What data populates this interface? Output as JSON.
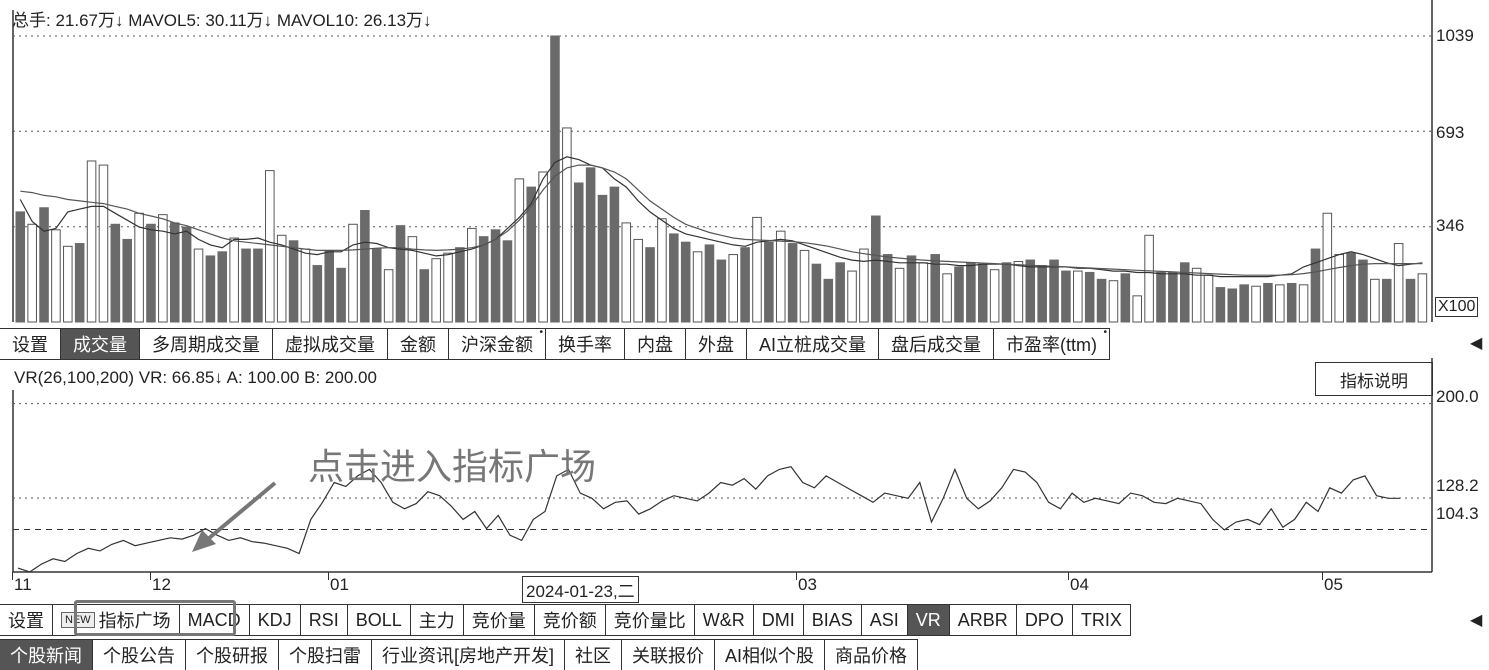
{
  "volume_panel": {
    "header": "总手: 21.67万↓ MAVOL5: 30.11万↓ MAVOL10: 26.13万↓",
    "y_ticks": [
      "1039",
      "693",
      "346"
    ],
    "unit": "X100"
  },
  "volume_tabs": [
    "设置",
    "成交量",
    "多周期成交量",
    "虚拟成交量",
    "金额",
    "沪深金额",
    "换手率",
    "内盘",
    "外盘",
    "AI立桩成交量",
    "盘后成交量",
    "市盈率(ttm)"
  ],
  "volume_tabs_marked": [
    "沪深金额",
    "市盈率(ttm)"
  ],
  "volume_tab_active": "成交量",
  "vr_panel": {
    "header": "VR(26,100,200) VR: 66.85↓ A: 100.00 B: 200.00",
    "help_button": "指标说明",
    "y_ticks": [
      "200.0",
      "128.2",
      "104.3"
    ],
    "annotation": "点击进入指标广场"
  },
  "x_axis": {
    "labels": [
      "11",
      "12",
      "01",
      "03",
      "04",
      "05"
    ],
    "cursor_date": "2024-01-23,二"
  },
  "indicator_tabs": [
    "设置",
    "指标广场",
    "MACD",
    "KDJ",
    "RSI",
    "BOLL",
    "主力",
    "竞价量",
    "竞价额",
    "竞价量比",
    "W&R",
    "DMI",
    "BIAS",
    "ASI",
    "VR",
    "ARBR",
    "DPO",
    "TRIX"
  ],
  "indicator_new_badge": "NEW",
  "indicator_tab_active": "VR",
  "info_tabs": [
    "个股新闻",
    "个股公告",
    "个股研报",
    "个股扫雷",
    "行业资讯[房地产开发]",
    "社区",
    "关联报价",
    "AI相似个股",
    "商品价格"
  ],
  "info_tab_active": "个股新闻",
  "chart_data": [
    {
      "type": "bar",
      "name": "volume",
      "ylim": [
        0,
        1039
      ],
      "y_ticks": [
        346,
        693,
        1039
      ],
      "values": [
        400,
        355,
        415,
        335,
        275,
        285,
        585,
        570,
        355,
        300,
        395,
        355,
        390,
        360,
        345,
        265,
        240,
        255,
        305,
        265,
        265,
        550,
        315,
        295,
        265,
        205,
        260,
        195,
        355,
        405,
        265,
        190,
        350,
        310,
        190,
        230,
        250,
        270,
        340,
        310,
        335,
        295,
        520,
        490,
        545,
        1039,
        705,
        505,
        560,
        460,
        490,
        360,
        300,
        270,
        375,
        320,
        290,
        255,
        280,
        225,
        245,
        270,
        380,
        290,
        330,
        285,
        260,
        210,
        155,
        215,
        185,
        265,
        385,
        245,
        195,
        240,
        215,
        245,
        175,
        200,
        215,
        210,
        190,
        215,
        220,
        225,
        205,
        225,
        185,
        185,
        180,
        155,
        150,
        175,
        95,
        315,
        180,
        180,
        215,
        195,
        170,
        125,
        120,
        135,
        130,
        140,
        135,
        140,
        135,
        265,
        395,
        245,
        250,
        225,
        155,
        155,
        285,
        155,
        175
      ],
      "up": [
        false,
        true,
        false,
        true,
        true,
        false,
        true,
        true,
        false,
        false,
        true,
        false,
        true,
        false,
        false,
        true,
        false,
        false,
        true,
        false,
        false,
        true,
        true,
        false,
        true,
        false,
        false,
        false,
        true,
        false,
        false,
        true,
        false,
        true,
        false,
        true,
        true,
        false,
        true,
        false,
        false,
        false,
        true,
        false,
        true,
        false,
        true,
        false,
        false,
        false,
        false,
        true,
        true,
        false,
        true,
        false,
        false,
        true,
        false,
        false,
        true,
        false,
        true,
        false,
        true,
        false,
        true,
        false,
        false,
        false,
        true,
        true,
        false,
        false,
        true,
        false,
        true,
        false,
        true,
        false,
        false,
        false,
        true,
        false,
        true,
        false,
        false,
        false,
        false,
        true,
        false,
        false,
        true,
        false,
        true,
        true,
        false,
        false,
        false,
        true,
        true,
        false,
        false,
        false,
        true,
        false,
        true,
        false,
        true,
        false,
        true,
        true,
        false,
        false,
        true,
        false,
        true,
        false,
        true
      ],
      "series": [
        {
          "name": "MAVOL5",
          "values": [
            445,
            365,
            330,
            340,
            400,
            410,
            420,
            420,
            395,
            370,
            345,
            335,
            330,
            320,
            330,
            300,
            280,
            270,
            300,
            300,
            305,
            290,
            280,
            265,
            250,
            245,
            255,
            255,
            280,
            290,
            285,
            270,
            265,
            260,
            250,
            240,
            245,
            255,
            265,
            280,
            300,
            340,
            380,
            430,
            520,
            580,
            600,
            590,
            570,
            560,
            520,
            490,
            440,
            400,
            370,
            340,
            320,
            310,
            300,
            290,
            280,
            275,
            290,
            295,
            300,
            295,
            280,
            265,
            250,
            235,
            225,
            220,
            225,
            220,
            215,
            215,
            215,
            210,
            210,
            205,
            205,
            210,
            210,
            210,
            205,
            200,
            200,
            200,
            200,
            195,
            195,
            190,
            185,
            185,
            180,
            180,
            175,
            175,
            175,
            170,
            170,
            165,
            165,
            165,
            165,
            165,
            170,
            175,
            200,
            215,
            230,
            245,
            255,
            245,
            230,
            215,
            205,
            210,
            215
          ]
        },
        {
          "name": "MAVOL10",
          "values": [
            475,
            470,
            460,
            455,
            445,
            440,
            435,
            430,
            420,
            410,
            395,
            385,
            375,
            360,
            350,
            335,
            320,
            305,
            295,
            290,
            285,
            280,
            275,
            270,
            265,
            260,
            260,
            260,
            262,
            265,
            268,
            270,
            270,
            265,
            262,
            260,
            262,
            265,
            270,
            280,
            300,
            330,
            370,
            420,
            480,
            530,
            560,
            570,
            570,
            560,
            545,
            520,
            480,
            440,
            410,
            380,
            355,
            340,
            325,
            315,
            305,
            300,
            298,
            296,
            294,
            292,
            288,
            282,
            275,
            265,
            255,
            248,
            242,
            236,
            232,
            228,
            225,
            222,
            220,
            218,
            216,
            214,
            212,
            210,
            208,
            206,
            204,
            202,
            200,
            198,
            196,
            194,
            192,
            190,
            188,
            186,
            184,
            182,
            180,
            178,
            176,
            174,
            172,
            170,
            170,
            170,
            170,
            172,
            176,
            182,
            190,
            198,
            205,
            210,
            212,
            212,
            212,
            212,
            212
          ]
        }
      ]
    },
    {
      "type": "line",
      "name": "VR",
      "ylim": [
        72,
        205
      ],
      "y_ticks": [
        104.3,
        128.2,
        200.0
      ],
      "series": [
        {
          "name": "VR",
          "values": [
            75,
            72,
            78,
            82,
            80,
            86,
            90,
            88,
            93,
            96,
            92,
            94,
            96,
            98,
            97,
            100,
            105,
            100,
            96,
            98,
            95,
            94,
            92,
            90,
            86,
            112,
            125,
            140,
            137,
            145,
            150,
            140,
            125,
            120,
            124,
            133,
            130,
            122,
            112,
            118,
            105,
            115,
            100,
            96,
            112,
            118,
            145,
            150,
            132,
            128,
            120,
            125,
            126,
            116,
            120,
            126,
            130,
            128,
            126,
            132,
            140,
            138,
            143,
            135,
            145,
            150,
            152,
            140,
            136,
            145,
            140,
            135,
            130,
            125,
            132,
            130,
            128,
            140,
            110,
            128,
            150,
            128,
            120,
            126,
            136,
            150,
            148,
            140,
            125,
            120,
            132,
            125,
            128,
            126,
            124,
            132,
            130,
            125,
            124,
            128,
            126,
            124,
            112,
            104,
            110,
            112,
            108,
            120,
            106,
            112,
            125,
            118,
            136,
            132,
            142,
            145,
            130,
            128,
            128
          ]
        }
      ]
    }
  ]
}
